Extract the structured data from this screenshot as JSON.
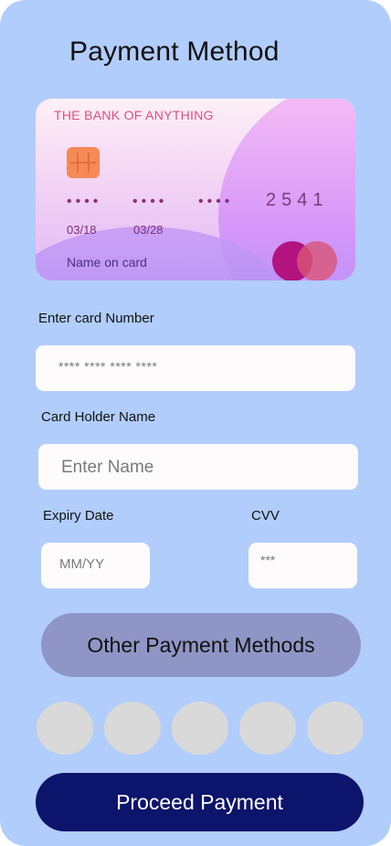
{
  "header": {
    "title": "Payment Method"
  },
  "card": {
    "bank_name": "THE BANK OF ANYTHING",
    "number_masked_groups": [
      "••••",
      "••••",
      "••••"
    ],
    "last_four": "2541",
    "issue_date": "03/18",
    "expiry_date": "03/28",
    "name_label": "Name on card"
  },
  "form": {
    "card_number": {
      "label": "Enter card Number",
      "placeholder": "**** **** **** ****"
    },
    "holder_name": {
      "label": "Card Holder Name",
      "placeholder": "Enter Name"
    },
    "expiry": {
      "label": "Expiry Date",
      "placeholder": "MM/YY"
    },
    "cvv": {
      "label": "CVV",
      "placeholder": "***"
    }
  },
  "buttons": {
    "other_methods": "Other Payment Methods",
    "proceed": "Proceed Payment"
  },
  "colors": {
    "background": "#b1cdfb",
    "primary_button": "#0c146b",
    "secondary_button": "#8f96c6",
    "method_placeholder": "#d9d9d9"
  }
}
